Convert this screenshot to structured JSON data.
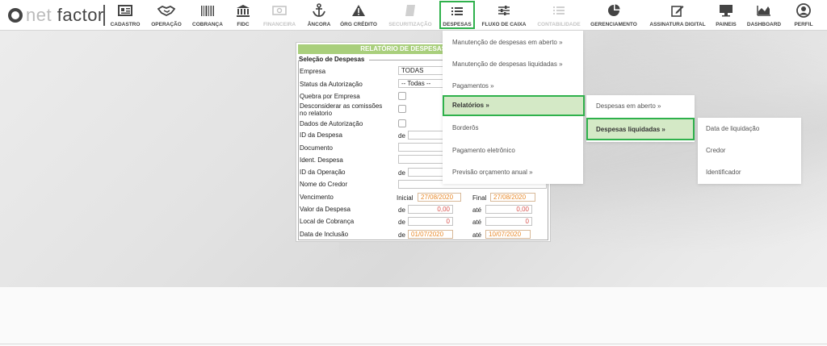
{
  "logo": {
    "part1": "ne",
    "part2": "t",
    "part3": "factor"
  },
  "nav": [
    {
      "label": "CADASTRO",
      "icon": "id-card-icon",
      "disabled": false
    },
    {
      "label": "OPERAÇÃO",
      "icon": "handshake-icon",
      "disabled": false
    },
    {
      "label": "COBRANÇA",
      "icon": "barcode-icon",
      "disabled": false
    },
    {
      "label": "FIDC",
      "icon": "bank-icon",
      "disabled": false
    },
    {
      "label": "FINANCEIRA",
      "icon": "money-icon",
      "disabled": true
    },
    {
      "label": "ÂNCORA",
      "icon": "anchor-icon",
      "disabled": false
    },
    {
      "label": "ÓRG CRÉDITO",
      "icon": "warning-icon",
      "disabled": false
    },
    {
      "label": "SECURITIZAÇÃO",
      "icon": "document-icon",
      "disabled": true
    },
    {
      "label": "DESPESAS",
      "icon": "list-icon",
      "disabled": false,
      "active": true
    },
    {
      "label": "FLUXO DE CAIXA",
      "icon": "sliders-icon",
      "disabled": false
    },
    {
      "label": "CONTABILIDADE",
      "icon": "list-icon",
      "disabled": true
    },
    {
      "label": "GERENCIAMENTO",
      "icon": "pie-chart-icon",
      "disabled": false
    },
    {
      "label": "ASSINATURA DIGITAL",
      "icon": "edit-icon",
      "disabled": false
    },
    {
      "label": "PAINEIS",
      "icon": "monitor-icon",
      "disabled": false
    },
    {
      "label": "DASHBOARD",
      "icon": "area-chart-icon",
      "disabled": false
    },
    {
      "label": "PERFIL",
      "icon": "user-icon",
      "disabled": false
    }
  ],
  "form": {
    "title": "RELATÓRIO DE DESPESAS EM ABERTO",
    "section": "Seleção de Despesas",
    "empresa_label": "Empresa",
    "empresa_value": "TODAS",
    "status_label": "Status da Autorização",
    "status_value": "-- Todas --",
    "quebra_label": "Quebra por Empresa",
    "desconsiderar_label_1": "Desconsiderar as comissões",
    "desconsiderar_label_2": "no relatorio",
    "dados_label": "Dados de Autorização",
    "id_despesa_label": "ID da Despesa",
    "de": "de",
    "ate": "até",
    "documento_label": "Documento",
    "ident_label": "Ident. Despesa",
    "id_operacao_label": "ID da Operação",
    "credor_label": "Nome do Credor",
    "vencimento_label": "Vencimento",
    "inicial": "Inicial",
    "final": "Final",
    "venc_inicial": "27/08/2020",
    "venc_final": "27/08/2020",
    "valor_label": "Valor da Despesa",
    "valor_de": "0,00",
    "valor_ate": "0,00",
    "local_label": "Local de Cobrança",
    "local_de": "0",
    "local_ate": "0",
    "inclusao_label": "Data de Inclusão",
    "inclusao_de": "01/07/2020",
    "inclusao_ate": "10/07/2020"
  },
  "menu1": [
    "Manutenção de despesas em aberto  »",
    "Manutenção de despesas liquidadas  »",
    "Pagamentos  »",
    "Relatórios  »",
    "Borderôs",
    "Pagamento eletrônico",
    "Previsão orçamento anual  »"
  ],
  "menu2": [
    "Despesas em aberto  »",
    "Despesas liquidadas  »"
  ],
  "menu3": [
    "Data de liquidação",
    "Credor",
    "Identificador"
  ],
  "colors": {
    "accent_green": "#2fb14c",
    "header_green": "#a9cf7c",
    "highlight": "#d4e9c6",
    "orange": "#e88a2b",
    "red": "#d9534f"
  }
}
